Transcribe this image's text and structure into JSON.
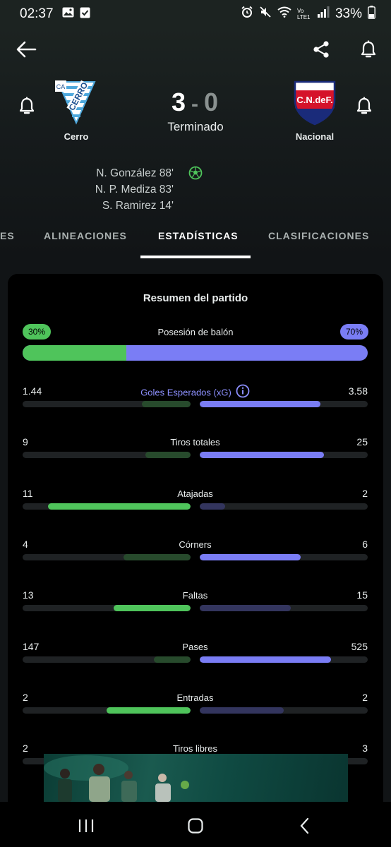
{
  "status_bar": {
    "time": "02:37",
    "lte_label": "Vo LTE1",
    "battery": "33%"
  },
  "header": {
    "home_team": {
      "name": "Cerro",
      "logo_text": "CERRO",
      "logo_corner": "CA"
    },
    "away_team": {
      "name": "Nacional",
      "logo_text": "C.N.deF."
    },
    "score_home": "3",
    "score_separator": "-",
    "score_away": "0",
    "match_status": "Terminado",
    "scorers": [
      "N. González 88'",
      "N. P. Mediza 83'",
      "S. Ramirez 14'"
    ]
  },
  "tabs": [
    {
      "label": "ES",
      "active": false
    },
    {
      "label": "ALINEACIONES",
      "active": false
    },
    {
      "label": "ESTADÍSTICAS",
      "active": true
    },
    {
      "label": "CLASIFICACIONES",
      "active": false
    }
  ],
  "summary": {
    "title": "Resumen del partido",
    "possession": {
      "label": "Posesión de balón",
      "home": "30%",
      "away": "70%",
      "home_fraction": 0.3
    },
    "stats": [
      {
        "label": "Goles Esperados (xG)",
        "home": "1.44",
        "away": "3.58",
        "home_fill": 0.29,
        "away_fill": 0.72,
        "home_leads": false,
        "is_link": true
      },
      {
        "label": "Tiros totales",
        "home": "9",
        "away": "25",
        "home_fill": 0.27,
        "away_fill": 0.74,
        "home_leads": false,
        "is_link": false
      },
      {
        "label": "Atajadas",
        "home": "11",
        "away": "2",
        "home_fill": 0.85,
        "away_fill": 0.15,
        "home_leads": true,
        "is_link": false
      },
      {
        "label": "Córners",
        "home": "4",
        "away": "6",
        "home_fill": 0.4,
        "away_fill": 0.6,
        "home_leads": false,
        "is_link": false
      },
      {
        "label": "Faltas",
        "home": "13",
        "away": "15",
        "home_fill": 0.46,
        "away_fill": 0.54,
        "home_leads": true,
        "is_link": false
      },
      {
        "label": "Pases",
        "home": "147",
        "away": "525",
        "home_fill": 0.22,
        "away_fill": 0.78,
        "home_leads": false,
        "is_link": false
      },
      {
        "label": "Entradas",
        "home": "2",
        "away": "2",
        "home_fill": 0.5,
        "away_fill": 0.5,
        "home_leads": true,
        "is_link": false
      },
      {
        "label": "Tiros libres",
        "home": "2",
        "away": "3",
        "home_fill": 0.4,
        "away_fill": 0.6,
        "home_leads": false,
        "is_link": false
      }
    ]
  },
  "colors": {
    "home_accent": "#4fc45b",
    "home_dim": "#274a2c",
    "away_accent": "#7a7df5",
    "away_dim": "#33355e",
    "track": "#1f2224"
  }
}
